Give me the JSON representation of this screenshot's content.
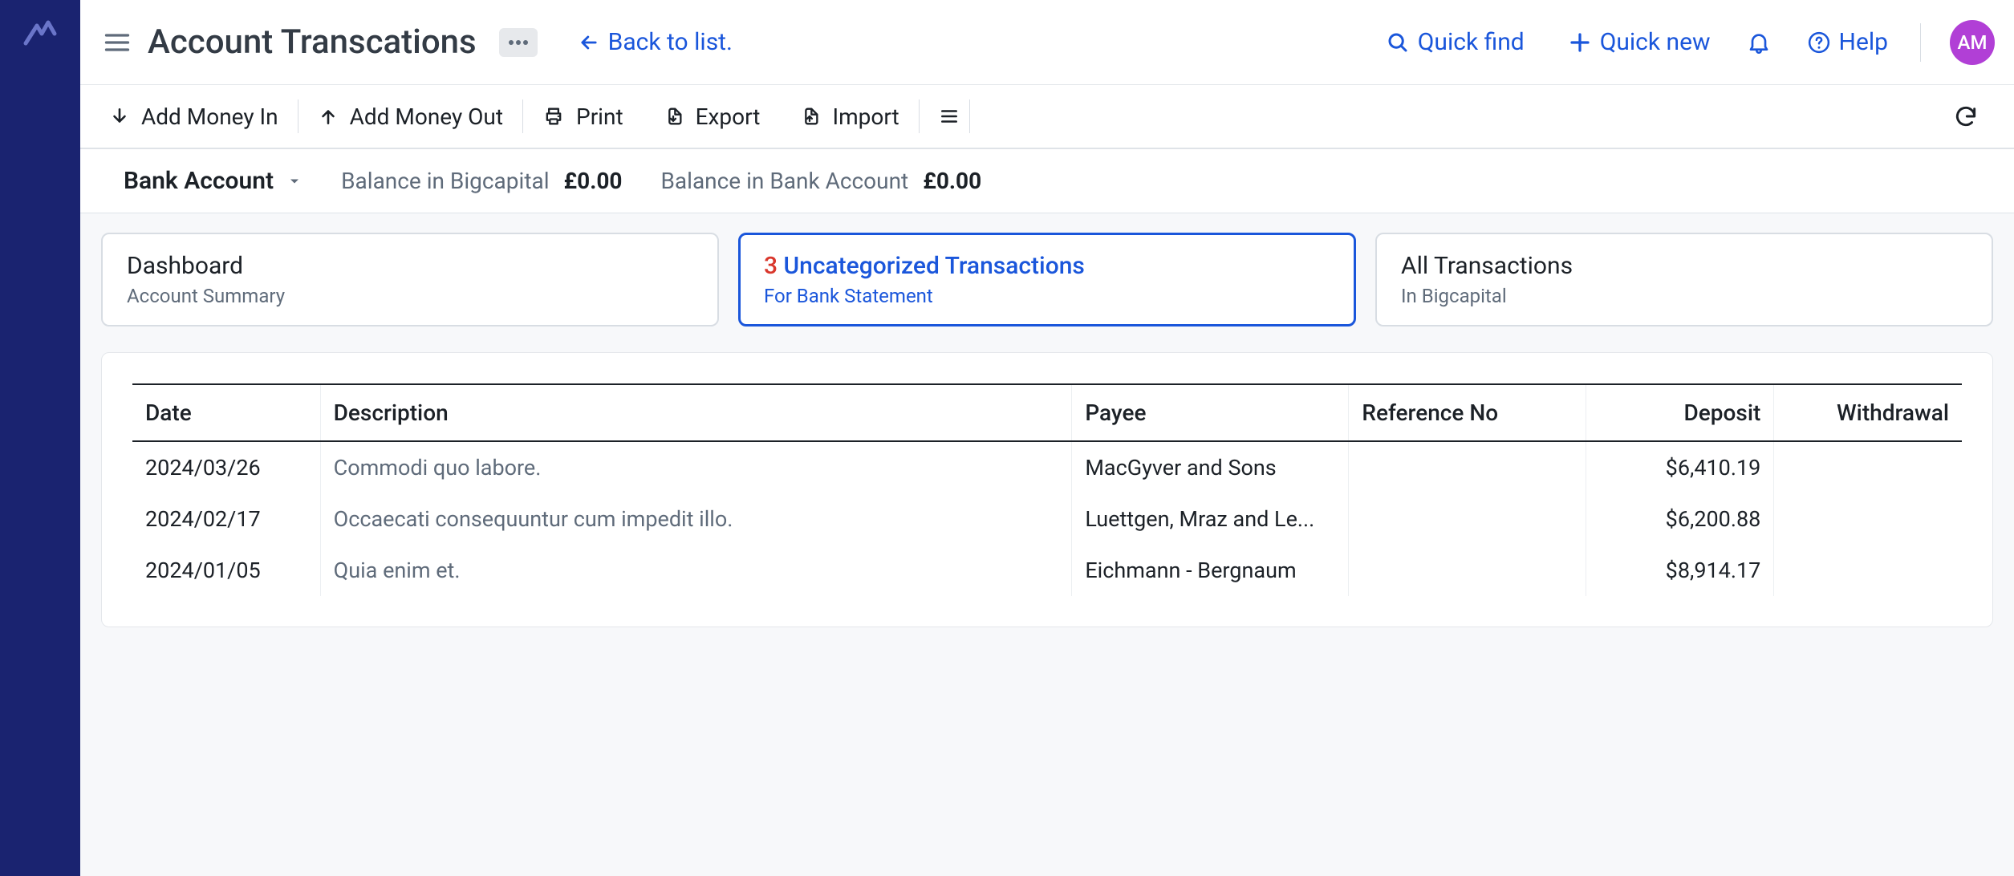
{
  "header": {
    "page_title": "Account Transcations",
    "back_link": "Back to list.",
    "quick_find": "Quick find",
    "quick_new": "Quick new",
    "help": "Help",
    "avatar_initials": "AM"
  },
  "actions": {
    "add_money_in": "Add Money In",
    "add_money_out": "Add Money Out",
    "print": "Print",
    "export": "Export",
    "import": "Import"
  },
  "balances": {
    "account_selector_label": "Bank Account",
    "app_label": "Balance in Bigcapital",
    "app_value": "£0.00",
    "bank_label": "Balance in Bank Account",
    "bank_value": "£0.00"
  },
  "tabs": {
    "dashboard": {
      "title": "Dashboard",
      "subtitle": "Account Summary"
    },
    "uncat": {
      "count": "3",
      "title_rest": " Uncategorized Transactions",
      "subtitle": "For Bank Statement"
    },
    "all": {
      "title": "All Transactions",
      "subtitle": "In Bigcapital"
    }
  },
  "table": {
    "headers": {
      "date": "Date",
      "description": "Description",
      "payee": "Payee",
      "reference": "Reference No",
      "deposit": "Deposit",
      "withdrawal": "Withdrawal"
    },
    "rows": [
      {
        "date": "2024/03/26",
        "description": "Commodi quo labore.",
        "payee": "MacGyver and Sons",
        "reference": "",
        "deposit": "$6,410.19",
        "withdrawal": ""
      },
      {
        "date": "2024/02/17",
        "description": "Occaecati consequuntur cum impedit illo.",
        "payee": "Luettgen, Mraz and Le...",
        "reference": "",
        "deposit": "$6,200.88",
        "withdrawal": ""
      },
      {
        "date": "2024/01/05",
        "description": "Quia enim et.",
        "payee": "Eichmann - Bergnaum",
        "reference": "",
        "deposit": "$8,914.17",
        "withdrawal": ""
      }
    ]
  }
}
